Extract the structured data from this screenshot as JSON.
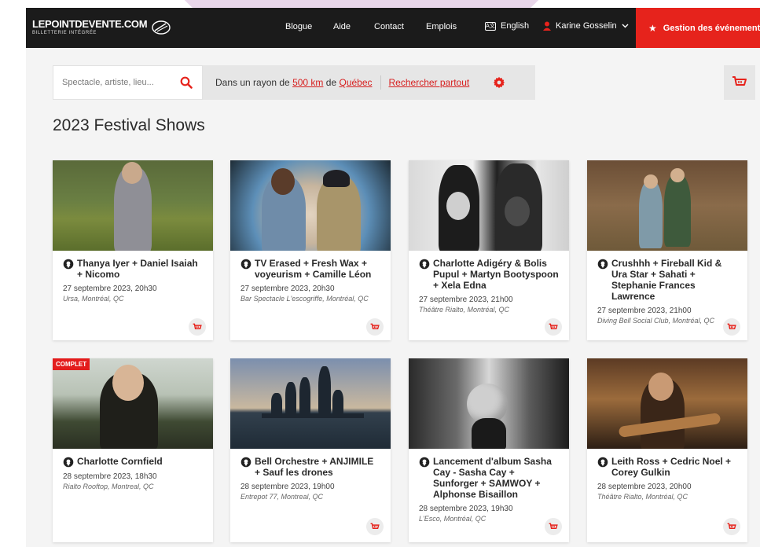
{
  "nav": {
    "brand_name": "LEPOINTDEVENTE.COM",
    "brand_sub": "BILLETTERIE INTÉGRÉE",
    "links": [
      "Blogue",
      "Aide",
      "Contact",
      "Emplois"
    ],
    "language": "English",
    "user": "Karine Gosselin",
    "cta": "Gestion des événements"
  },
  "search": {
    "placeholder": "Spectacle, artiste, lieu...",
    "radius_prefix": "Dans un rayon de",
    "radius_value": "500 km",
    "radius_mid": "de",
    "city": "Québec",
    "search_everywhere": "Rechercher partout"
  },
  "page": {
    "title": "2023 Festival Shows"
  },
  "events": [
    {
      "title": "Thanya Iyer + Daniel Isaiah + Nicomo",
      "date": "27 septembre 2023, 20h30",
      "venue": "Ursa, Montréal, QC",
      "badge": ""
    },
    {
      "title": "TV Erased + Fresh Wax + voyeurism + Camille Léon",
      "date": "27 septembre 2023, 20h30",
      "venue": "Bar Spectacle L'escogriffe, Montréal, QC",
      "badge": ""
    },
    {
      "title": "Charlotte Adigéry & Bolis Pupul + Martyn Bootyspoon + Xela Edna",
      "date": "27 septembre 2023, 21h00",
      "venue": "Théâtre Rialto, Montréal, QC",
      "badge": ""
    },
    {
      "title": "Crushhh + Fireball Kid & Ura Star + Sahati + Stephanie Frances Lawrence",
      "date": "27 septembre 2023, 21h00",
      "venue": "Diving Bell Social Club, Montréal, QC",
      "badge": ""
    },
    {
      "title": "Charlotte Cornfield",
      "date": "28 septembre 2023, 18h30",
      "venue": "Rialto Rooftop, Montreal, QC",
      "badge": "COMPLET"
    },
    {
      "title": "Bell Orchestre + ANJIMILE + Sauf les drones",
      "date": "28 septembre 2023, 19h00",
      "venue": "Entrepot 77, Montreal, QC",
      "badge": ""
    },
    {
      "title": "Lancement d'album Sasha Cay - Sasha Cay + Sunforger + SAMWOY + Alphonse Bisaillon",
      "date": "28 septembre 2023, 19h30",
      "venue": "L'Esco, Montréal, QC",
      "badge": ""
    },
    {
      "title": "Leith Ross + Cedric Noel + Corey Gulkin",
      "date": "28 septembre 2023, 20h00",
      "venue": "Théâtre Rialto, Montréal, QC",
      "badge": ""
    }
  ],
  "colors": {
    "accent": "#e6231c",
    "nav_bg": "#1b1b1b",
    "page_bg": "#f4f4f4"
  },
  "icons": {
    "search": "search-icon",
    "gear": "gear-icon",
    "cart": "cart-icon",
    "pin": "location-pin-icon",
    "user": "user-icon",
    "star": "star-icon",
    "language": "language-icon"
  }
}
